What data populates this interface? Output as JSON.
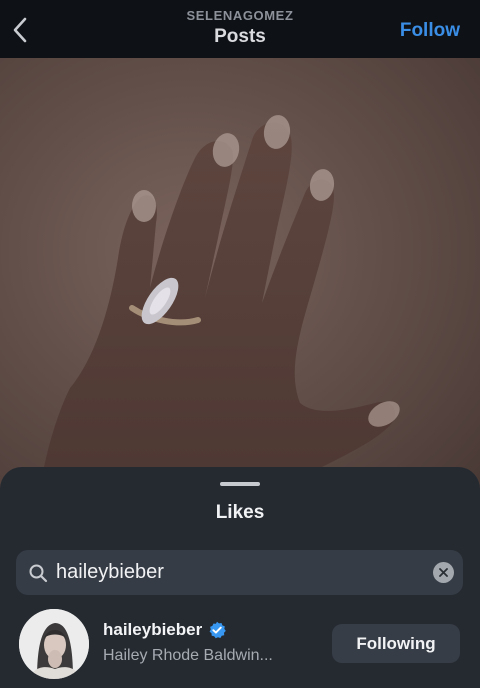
{
  "header": {
    "account": "SELENAGOMEZ",
    "title": "Posts",
    "follow_label": "Follow"
  },
  "post": {
    "image_alt": "Hand wearing a marquise diamond ring"
  },
  "likes_sheet": {
    "title": "Likes",
    "search": {
      "value": "haileybieber",
      "placeholder": "Search"
    },
    "results": [
      {
        "username": "haileybieber",
        "full_name": "Hailey Rhode Baldwin...",
        "verified": true,
        "button_label": "Following"
      }
    ]
  },
  "colors": {
    "accent": "#3a8ee6",
    "sheet_bg": "#252a31",
    "verified": "#3897f0"
  }
}
